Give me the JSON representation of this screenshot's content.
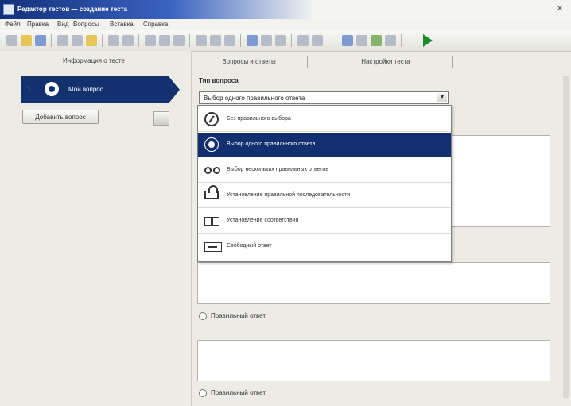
{
  "window": {
    "title": "Редактор тестов — создание теста",
    "close_label": "✕"
  },
  "menu": {
    "items": [
      "Файл",
      "Правка",
      "Вид",
      "Вопросы",
      "Вставка",
      "Справка"
    ]
  },
  "toolbar": {
    "buttons": [
      {
        "icon": "new-file-icon"
      },
      {
        "icon": "open-folder-icon"
      },
      {
        "icon": "save-icon"
      },
      {
        "icon": "cut-icon"
      },
      {
        "icon": "copy-icon"
      },
      {
        "icon": "paste-icon"
      },
      {
        "icon": "undo-icon"
      },
      {
        "icon": "redo-icon"
      },
      {
        "icon": "bold-icon"
      },
      {
        "icon": "italic-icon"
      },
      {
        "icon": "underline-icon"
      },
      {
        "icon": "align-left-icon"
      },
      {
        "icon": "align-center-icon"
      },
      {
        "icon": "align-right-icon"
      },
      {
        "icon": "insert-image-icon"
      },
      {
        "icon": "insert-table-icon"
      },
      {
        "icon": "run-icon"
      }
    ]
  },
  "left_panel": {
    "header": "Информация о тесте",
    "question_item": {
      "number": "1",
      "label": "Мой вопрос"
    },
    "add_question_label": "Добавить вопрос"
  },
  "tabs": [
    {
      "label": "Вопросы и ответы"
    },
    {
      "label": "Настройки теста"
    }
  ],
  "question_type": {
    "label": "Тип вопроса",
    "selected": "Выбор одного правильного ответа",
    "options": [
      {
        "label": "Без правильного выбора",
        "icon": "no-answer-icon"
      },
      {
        "label": "Выбор одного правильного ответа",
        "icon": "single-choice-icon",
        "selected": true
      },
      {
        "label": "Выбор нескольких правильных ответов",
        "icon": "multiple-choice-icon"
      },
      {
        "label": "Установление правильной последовательности",
        "icon": "sequence-icon"
      },
      {
        "label": "Установление соответствия",
        "icon": "matching-icon"
      },
      {
        "label": "Свободный ответ",
        "icon": "free-answer-icon"
      }
    ]
  },
  "answers": {
    "correct_label": "Правильный ответ"
  },
  "colors": {
    "selection": "#12306f",
    "run": "#1d8a2c"
  }
}
